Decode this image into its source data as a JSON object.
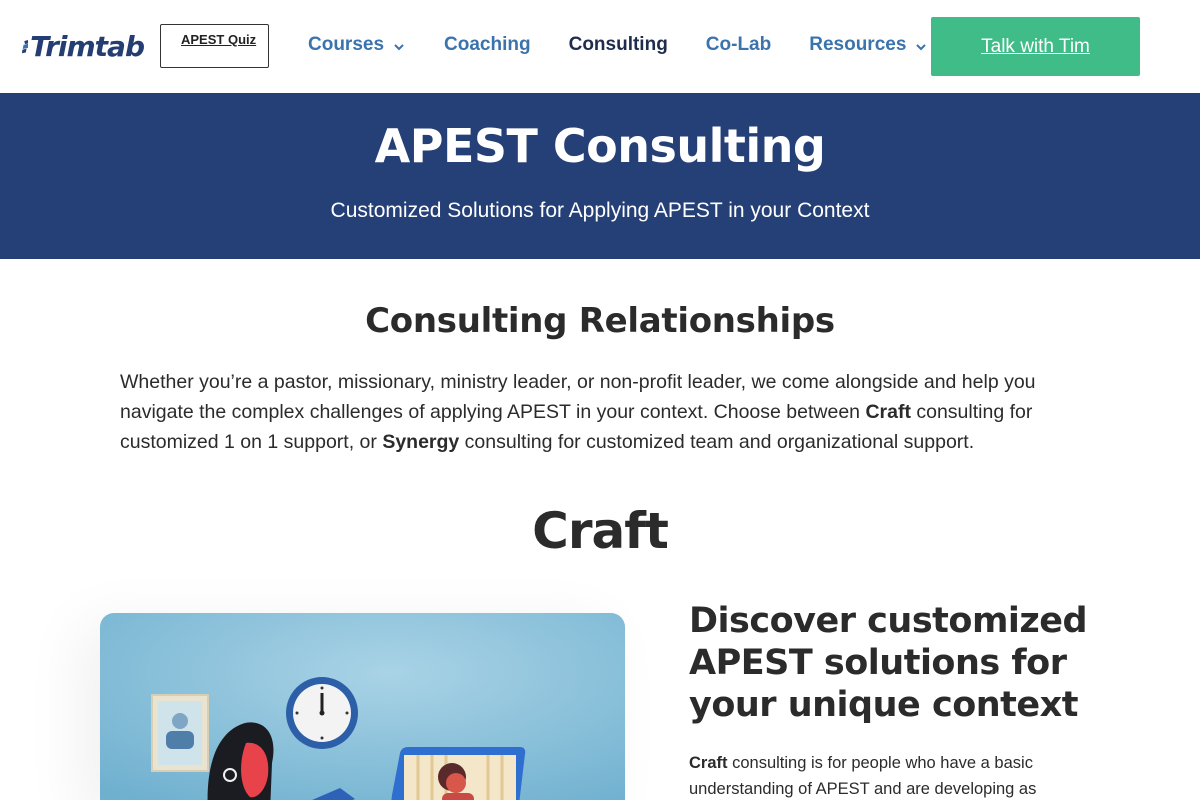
{
  "header": {
    "logo_text": "Trimtab",
    "quiz_button": "APEST Quiz",
    "nav": [
      {
        "label": "Courses",
        "has_dropdown": true,
        "active": false
      },
      {
        "label": "Coaching",
        "has_dropdown": false,
        "active": false
      },
      {
        "label": "Consulting",
        "has_dropdown": false,
        "active": true
      },
      {
        "label": "Co-Lab",
        "has_dropdown": false,
        "active": false
      },
      {
        "label": "Resources",
        "has_dropdown": true,
        "active": false
      }
    ],
    "cta_label": "Talk with Tim"
  },
  "hero": {
    "title": "APEST Consulting",
    "subtitle": "Customized Solutions for Applying APEST in your Context"
  },
  "relationships": {
    "title": "Consulting Relationships",
    "text_1": "Whether you’re a pastor, missionary, ministry leader, or non-profit leader, we come alongside and help you navigate the complex challenges of applying APEST in your context. Choose between ",
    "bold_1": "Craft",
    "text_2": " consulting for customized 1 on 1 support, or ",
    "bold_2": "Synergy",
    "text_3": " consulting for customized team and organizational support."
  },
  "craft": {
    "title": "Craft",
    "feature_title": "Discover customized APEST solutions for your unique context",
    "feature_bold": "Craft",
    "feature_text": " consulting is for people who have a basic understanding of APEST and are developing as"
  },
  "colors": {
    "brand_navy": "#253f77",
    "nav_blue": "#3b73ad",
    "cta_green": "#3fbc87",
    "text_dark": "#2b2b2b"
  },
  "icons": [
    "chevron-down-icon",
    "trimtab-logo-icon"
  ]
}
